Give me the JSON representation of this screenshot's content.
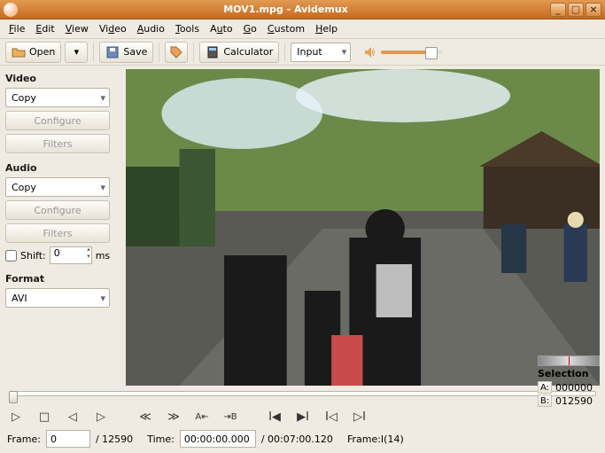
{
  "window": {
    "title": "MOV1.mpg - Avidemux"
  },
  "menus": [
    "File",
    "Edit",
    "View",
    "Video",
    "Audio",
    "Tools",
    "Auto",
    "Go",
    "Custom",
    "Help"
  ],
  "toolbar": {
    "open": "Open",
    "save": "Save",
    "calculator": "Calculator",
    "input_combo": "Input"
  },
  "side": {
    "video": {
      "heading": "Video",
      "codec": "Copy",
      "configure": "Configure",
      "filters": "Filters"
    },
    "audio": {
      "heading": "Audio",
      "codec": "Copy",
      "configure": "Configure",
      "filters": "Filters",
      "shift_label": "Shift:",
      "shift_value": "0",
      "shift_unit": "ms"
    },
    "format": {
      "heading": "Format",
      "value": "AVI"
    }
  },
  "controls": {
    "frame_label": "Frame:",
    "frame_value": "0",
    "frame_total": "/ 12590",
    "time_label": "Time:",
    "time_value": "00:00:00.000",
    "time_total": "/ 00:07:00.120",
    "frame_type": "Frame:I(14)"
  },
  "selection": {
    "heading": "Selection",
    "a_label": "A:",
    "a_value": "000000",
    "b_label": "B:",
    "b_value": "012590"
  }
}
